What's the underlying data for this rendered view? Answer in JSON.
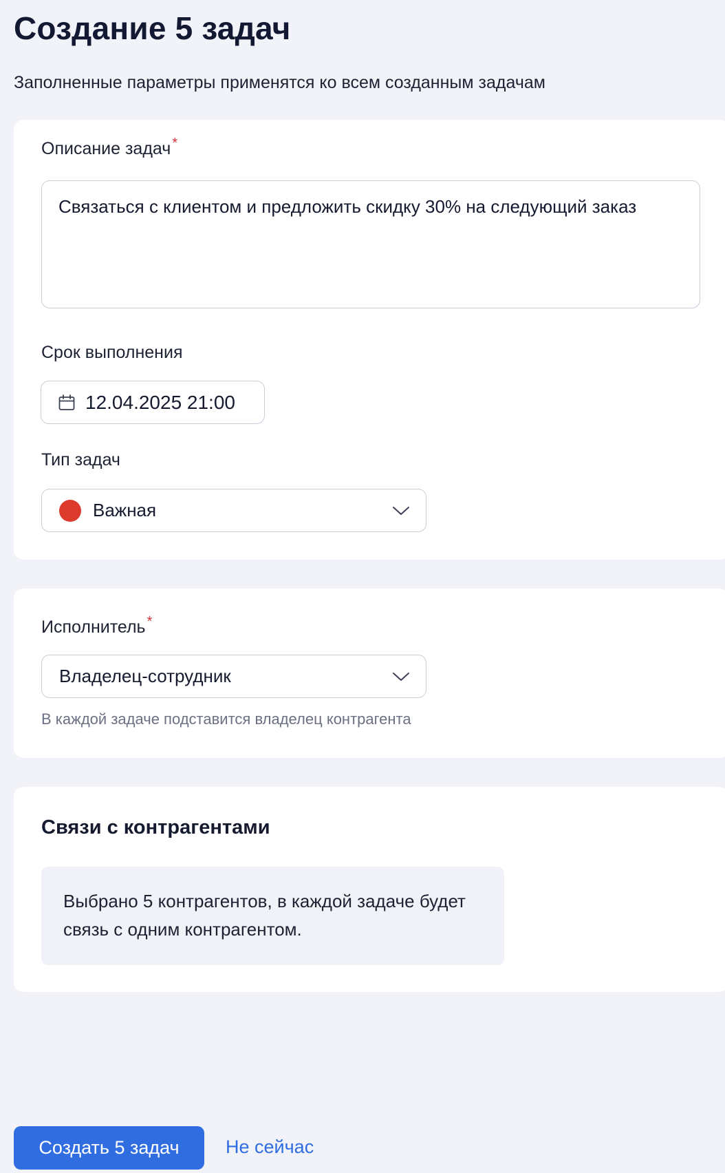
{
  "page": {
    "title": "Создание 5 задач",
    "subtitle": "Заполненные параметры применятся ко всем созданным задачам"
  },
  "task_description": {
    "label": "Описание задач",
    "required_mark": "*",
    "value": "Связаться с клиентом и предложить скидку 30% на следующий заказ"
  },
  "due_date": {
    "label": "Срок выполнения",
    "value": "12.04.2025 21:00",
    "icon": "calendar-icon"
  },
  "task_type": {
    "label": "Тип задач",
    "value": "Важная",
    "dot_color": "#dc3a2c",
    "icon": "chevron-down-icon"
  },
  "executor": {
    "label": "Исполнитель",
    "required_mark": "*",
    "value": "Владелец-сотрудник",
    "hint": "В каждой задаче подставится владелец контрагента",
    "icon": "chevron-down-icon"
  },
  "links": {
    "title": "Связи с контрагентами",
    "info": "Выбрано 5 контрагентов, в каждой задаче будет связь с одним контрагентом."
  },
  "actions": {
    "create_label": "Создать 5 задач",
    "cancel_label": "Не сейчас"
  },
  "colors": {
    "accent": "#2f6de0",
    "required": "#d8333a",
    "background": "#f2f3f8"
  }
}
